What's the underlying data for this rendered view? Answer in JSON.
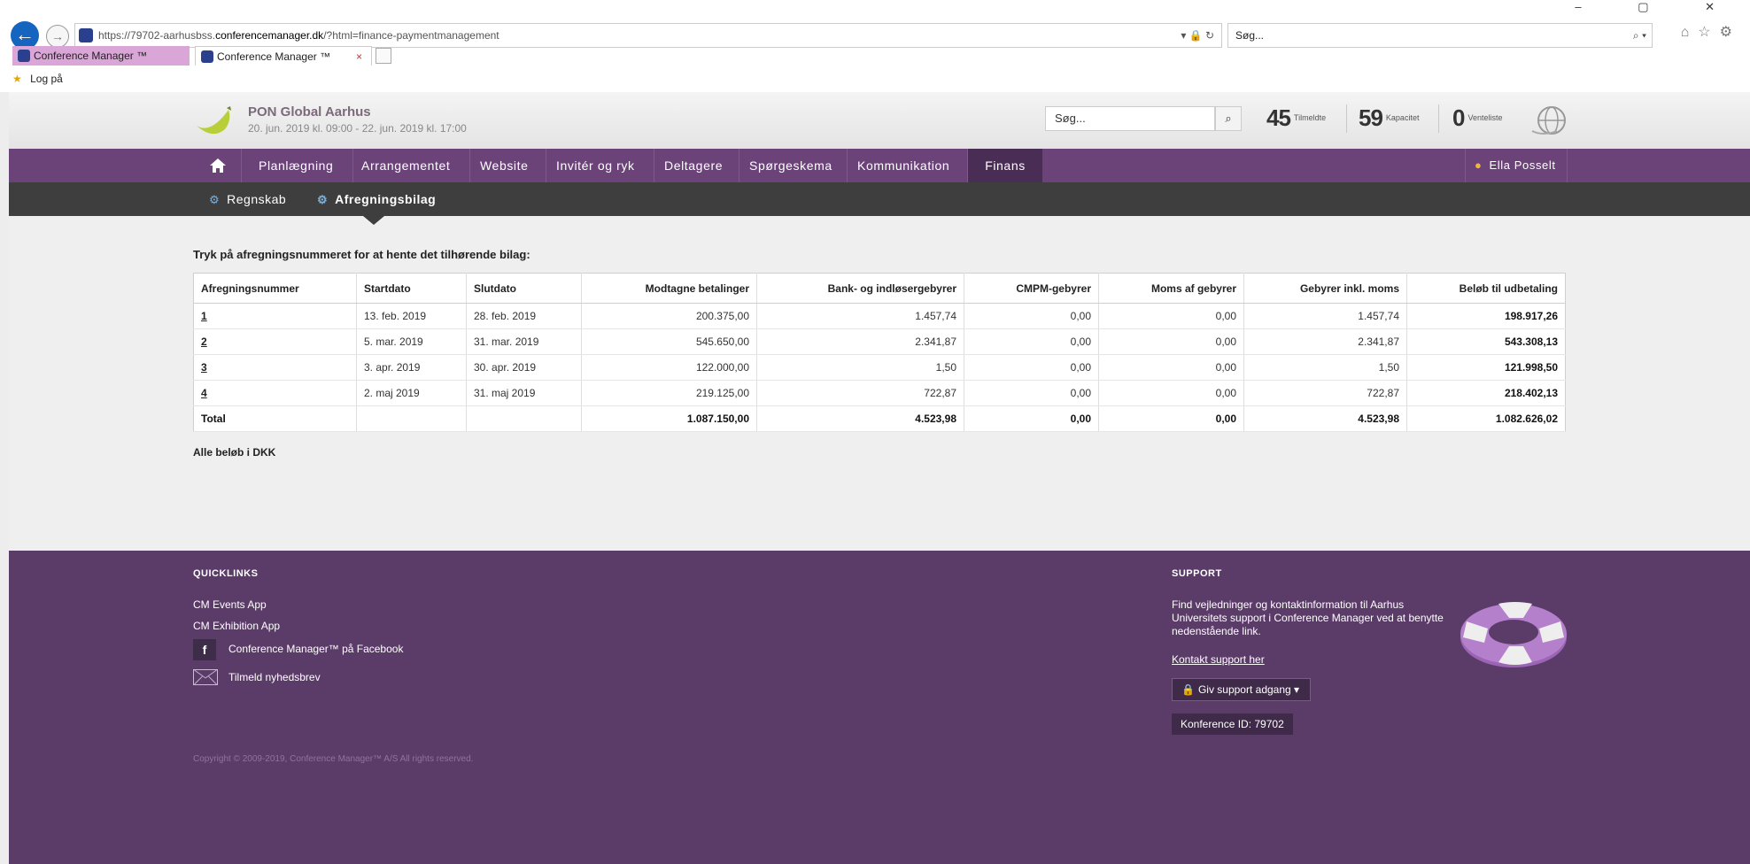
{
  "browser": {
    "url_prefix": "https://79702-aarhusbss.",
    "url_domain": "conferencemanager.dk",
    "url_suffix": "/?html=finance-paymentmanagement",
    "url_tools": "▾ 🔒 ↻",
    "search_placeholder": "Søg...",
    "tabs": [
      {
        "label": "Conference Manager ™"
      },
      {
        "label": "Conference Manager ™"
      }
    ],
    "close_tab": "×",
    "favorites_label": "Log på"
  },
  "header": {
    "conference_title": "PON Global Aarhus",
    "conference_dates": "20. jun. 2019 kl. 09:00 - 22. jun. 2019 kl. 17:00",
    "search_placeholder": "Søg...",
    "stats": [
      {
        "value": "45",
        "label": "Tilmeldte"
      },
      {
        "value": "59",
        "label": "Kapacitet"
      },
      {
        "value": "0",
        "label": "Venteliste"
      }
    ]
  },
  "nav": {
    "items": [
      {
        "label": "Planlægning"
      },
      {
        "label": "Arrangementet"
      },
      {
        "label": "Website"
      },
      {
        "label": "Invitér og ryk"
      },
      {
        "label": "Deltagere"
      },
      {
        "label": "Spørgeskema"
      },
      {
        "label": "Kommunikation"
      },
      {
        "label": "Finans"
      }
    ],
    "user": "Ella Posselt"
  },
  "subnav": {
    "items": [
      {
        "label": "Regnskab"
      },
      {
        "label": "Afregningsbilag"
      }
    ]
  },
  "content": {
    "intro": "Tryk på afregningsnummeret for at hente det tilhørende bilag:",
    "columns": [
      "Afregningsnummer",
      "Startdato",
      "Slutdato",
      "Modtagne betalinger",
      "Bank- og indløsergebyrer",
      "CMPM-gebyrer",
      "Moms af gebyrer",
      "Gebyrer inkl. moms",
      "Beløb til udbetaling"
    ],
    "rows": [
      [
        "1",
        "13. feb. 2019",
        "28. feb. 2019",
        "200.375,00",
        "1.457,74",
        "0,00",
        "0,00",
        "1.457,74",
        "198.917,26"
      ],
      [
        "2",
        "5. mar. 2019",
        "31. mar. 2019",
        "545.650,00",
        "2.341,87",
        "0,00",
        "0,00",
        "2.341,87",
        "543.308,13"
      ],
      [
        "3",
        "3. apr. 2019",
        "30. apr. 2019",
        "122.000,00",
        "1,50",
        "0,00",
        "0,00",
        "1,50",
        "121.998,50"
      ],
      [
        "4",
        "2. maj 2019",
        "31. maj 2019",
        "219.125,00",
        "722,87",
        "0,00",
        "0,00",
        "722,87",
        "218.402,13"
      ]
    ],
    "total": [
      "Total",
      "",
      "",
      "1.087.150,00",
      "4.523,98",
      "0,00",
      "0,00",
      "4.523,98",
      "1.082.626,02"
    ],
    "note": "Alle beløb i DKK"
  },
  "footer": {
    "quicklinks_title": "QUICKLINKS",
    "quicklinks": [
      "CM Events App",
      "CM Exhibition App",
      "Conference Manager™ på Facebook",
      "Tilmeld nyhedsbrev"
    ],
    "support_title": "SUPPORT",
    "support_text": "Find vejledninger og kontaktinformation til Aarhus Universitets support i Conference Manager ved at benytte nedenstående link.",
    "support_link": "Kontakt support her",
    "support_access": "Giv support adgang",
    "conference_id": "Konference ID: 79702",
    "copyright": "Copyright © 2009-2019, Conference Manager™ A/S All rights reserved."
  },
  "colors": {
    "nav": "#6b4379",
    "nav_active": "#4a2d55",
    "subnav": "#3e3e3e",
    "footer": "#5b3b68"
  }
}
